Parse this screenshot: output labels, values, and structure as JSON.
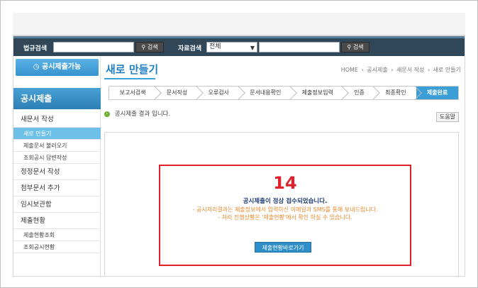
{
  "search_bar": {
    "law_label": "법규검색",
    "law_value": "",
    "law_button": "검색",
    "doc_label": "자료검색",
    "doc_select": "전체",
    "doc_value": "",
    "doc_button": "검색"
  },
  "sidebar": {
    "status_button": "공시제출가능",
    "title": "공시제출",
    "items": [
      {
        "label": "새문서 작성",
        "level": "main"
      },
      {
        "label": "새로 만들기",
        "level": "sub",
        "active": true
      },
      {
        "label": "제출문서 불러오기",
        "level": "sub"
      },
      {
        "label": "조회공시 답변작성",
        "level": "sub"
      },
      {
        "label": "정정문서 작성",
        "level": "main"
      },
      {
        "label": "첨부문서 추가",
        "level": "main"
      },
      {
        "label": "임시보관함",
        "level": "main"
      },
      {
        "label": "제출현황",
        "level": "main"
      },
      {
        "label": "제출현황조회",
        "level": "sub"
      },
      {
        "label": "조회공시현황",
        "level": "sub"
      }
    ]
  },
  "main": {
    "title": "새로 만들기",
    "breadcrumb": [
      "HOME",
      "공시제출",
      "새문서 작성",
      "새로 만들기"
    ],
    "steps": [
      {
        "label": "보고서검색"
      },
      {
        "label": "문서작성"
      },
      {
        "label": "오류검사"
      },
      {
        "label": "문서내용확인"
      },
      {
        "label": "제출정보입력"
      },
      {
        "label": "인증"
      },
      {
        "label": "최종확인"
      },
      {
        "label": "제출완료",
        "active": true
      }
    ],
    "result_text": "공시제출 결과 입니다.",
    "help_button": "도움말",
    "result": {
      "count": "14",
      "message": "공시제출이 정상 접수되었습니다.",
      "sub1": "- 공시처리결과는 제출정보에서 입력하신 이메일과 SMS를 통해 보내드립니다.",
      "sub2": "- 처리 진행상황은 '제출현황'에서 확인 하실 수 있습니다.",
      "button": "제출현황바로가기"
    }
  },
  "colors": {
    "accent": "#3a9fd6",
    "alert": "#e0212b",
    "searchbar": "#2f4758"
  }
}
